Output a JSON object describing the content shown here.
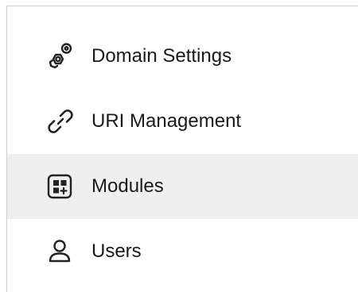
{
  "sidebar": {
    "items": [
      {
        "label": "Domain Settings",
        "icon": "gear-settings-icon",
        "selected": false
      },
      {
        "label": "URI Management",
        "icon": "link-icon",
        "selected": false
      },
      {
        "label": "Modules",
        "icon": "modules-grid-icon",
        "selected": true
      },
      {
        "label": "Users",
        "icon": "user-icon",
        "selected": false
      }
    ],
    "selected_background": "#efefef",
    "icon_color": "#222222",
    "text_color": "#1a1a1a"
  }
}
